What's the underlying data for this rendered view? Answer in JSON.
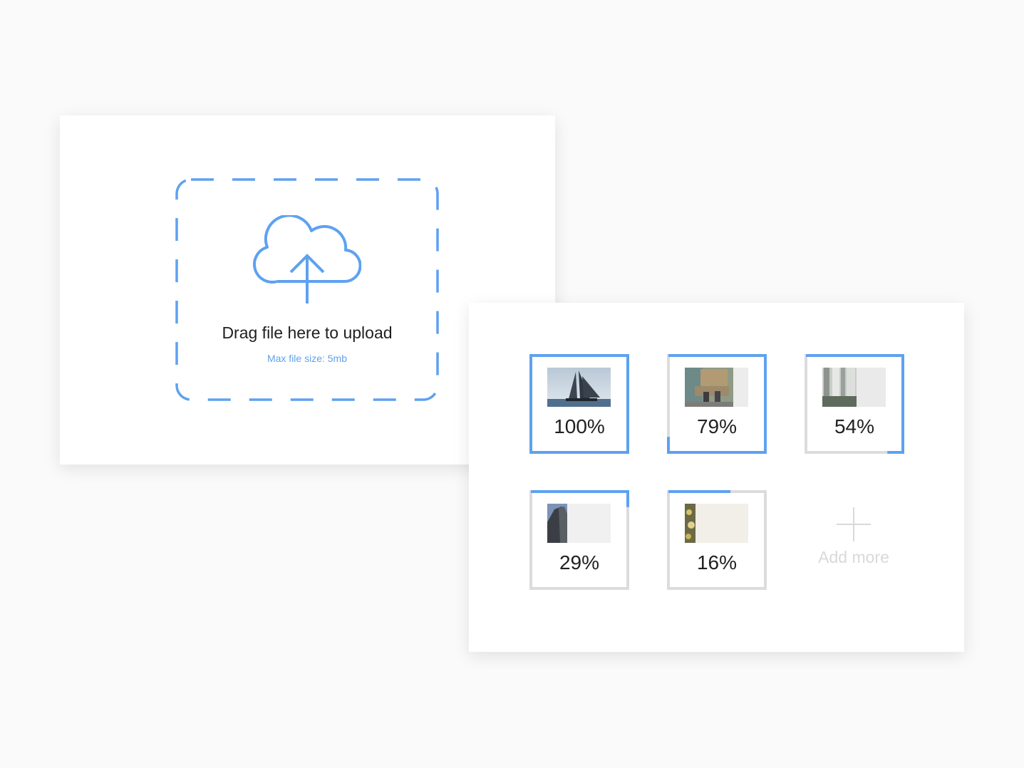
{
  "uploader": {
    "title": "Drag file here to upload",
    "subtitle": "Max file size: 5mb",
    "icon": "cloud-upload-icon"
  },
  "files": [
    {
      "progress_label": "100%",
      "progress": 1.0,
      "thumbnail": "sailing-ship-photo"
    },
    {
      "progress_label": "79%",
      "progress": 0.79,
      "thumbnail": "street-scene-photo"
    },
    {
      "progress_label": "54%",
      "progress": 0.54,
      "thumbnail": "waterfall-photo"
    },
    {
      "progress_label": "29%",
      "progress": 0.29,
      "thumbnail": "sea-cliff-photo"
    },
    {
      "progress_label": "16%",
      "progress": 0.16,
      "thumbnail": "flowers-photo"
    }
  ],
  "add_more": {
    "label": "Add more",
    "icon": "plus-icon"
  },
  "colors": {
    "accent": "#5ea1f0",
    "track": "#dcdcdc",
    "text": "#212121",
    "muted": "#d9d9d9",
    "background": "#fafafa"
  }
}
